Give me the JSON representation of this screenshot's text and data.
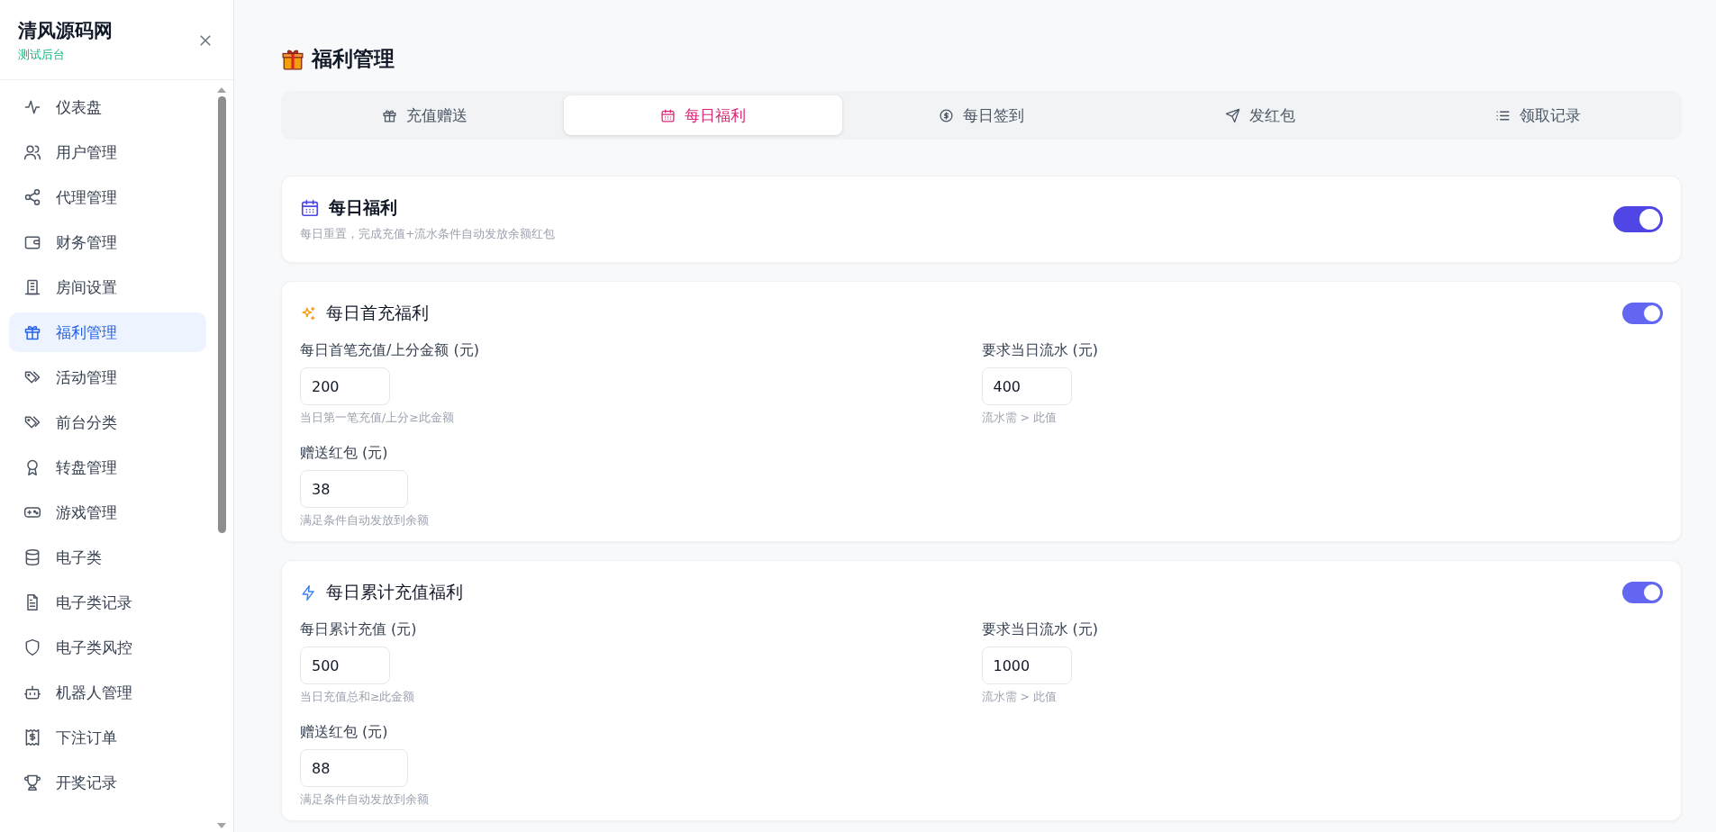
{
  "sidebar": {
    "brand": "清风源码网",
    "subtitle": "测试后台",
    "items": [
      {
        "label": "仪表盘",
        "selected": false
      },
      {
        "label": "用户管理",
        "selected": false
      },
      {
        "label": "代理管理",
        "selected": false
      },
      {
        "label": "财务管理",
        "selected": false
      },
      {
        "label": "房间设置",
        "selected": false
      },
      {
        "label": "福利管理",
        "selected": true
      },
      {
        "label": "活动管理",
        "selected": false
      },
      {
        "label": "前台分类",
        "selected": false
      },
      {
        "label": "转盘管理",
        "selected": false
      },
      {
        "label": "游戏管理",
        "selected": false
      },
      {
        "label": "电子类",
        "selected": false
      },
      {
        "label": "电子类记录",
        "selected": false
      },
      {
        "label": "电子类风控",
        "selected": false
      },
      {
        "label": "机器人管理",
        "selected": false
      },
      {
        "label": "下注订单",
        "selected": false
      },
      {
        "label": "开奖记录",
        "selected": false
      }
    ]
  },
  "page": {
    "title": "福利管理"
  },
  "tabs": [
    {
      "label": "充值赠送",
      "selected": false
    },
    {
      "label": "每日福利",
      "selected": true
    },
    {
      "label": "每日签到",
      "selected": false
    },
    {
      "label": "发红包",
      "selected": false
    },
    {
      "label": "领取记录",
      "selected": false
    }
  ],
  "header_card": {
    "title": "每日福利",
    "description": "每日重置，完成充值+流水条件自动发放余额红包",
    "on": true
  },
  "rules": [
    {
      "title": "每日首充福利",
      "on": true,
      "fields": [
        {
          "label": "每日首笔充值/上分金额 (元)",
          "value": "200",
          "hint": "当日第一笔充值/上分≥此金额"
        },
        {
          "label": "要求当日流水 (元)",
          "value": "400",
          "hint": "流水需 > 此值"
        },
        {
          "label": "赠送红包 (元)",
          "value": "38",
          "hint": "满足条件自动发放到余额"
        }
      ]
    },
    {
      "title": "每日累计充值福利",
      "on": true,
      "fields": [
        {
          "label": "每日累计充值 (元)",
          "value": "500",
          "hint": "当日充值总和≥此金额"
        },
        {
          "label": "要求当日流水 (元)",
          "value": "1000",
          "hint": "流水需 > 此值"
        },
        {
          "label": "赠送红包 (元)",
          "value": "88",
          "hint": "满足条件自动发放到余额"
        }
      ]
    }
  ]
}
